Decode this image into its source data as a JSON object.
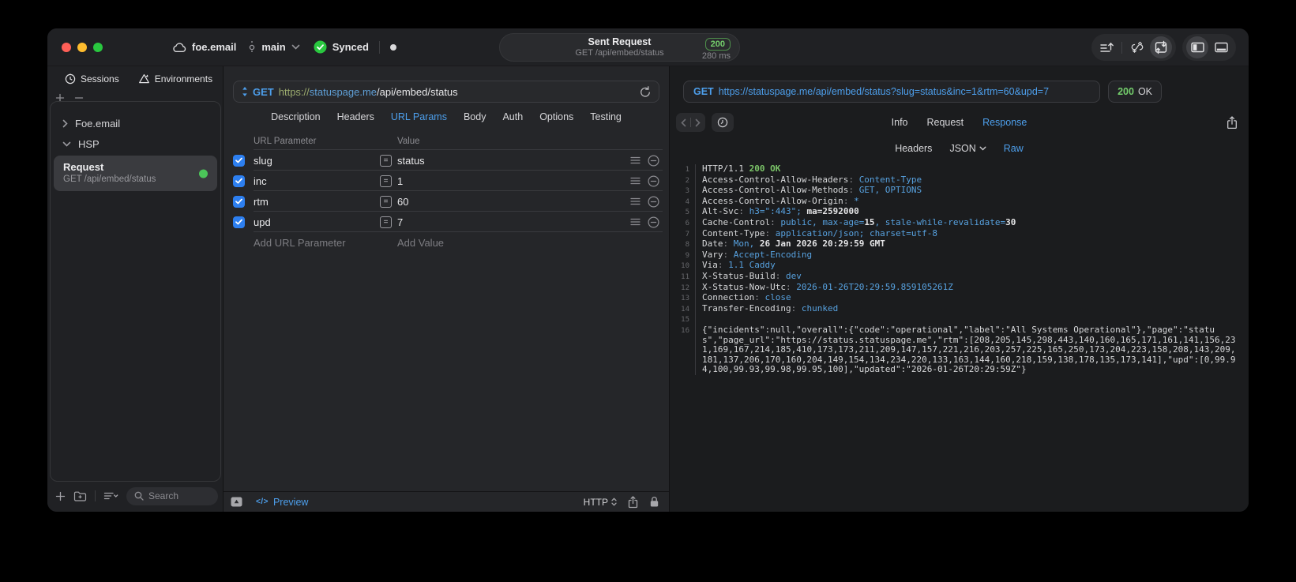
{
  "colors": {
    "accent_blue": "#4D9FEC",
    "status_green": "#74CE6C",
    "checkbox_blue": "#2D7FF0",
    "synced_green": "#29C73F"
  },
  "titlebar": {
    "workspace": "foe.email",
    "branch": "main",
    "sync_label": "Synced",
    "center": {
      "title": "Sent Request",
      "subtitle": "GET /api/embed/status",
      "status_code": "200",
      "duration": "280 ms"
    }
  },
  "sidebar": {
    "tabs": [
      {
        "label": "Sessions"
      },
      {
        "label": "Environments"
      }
    ],
    "tree": [
      {
        "label": "Foe.email"
      },
      {
        "label": "HSP"
      }
    ],
    "request": {
      "title": "Request",
      "subtitle": "GET /api/embed/status"
    },
    "search_placeholder": "Search"
  },
  "request_panel": {
    "method": "GET",
    "url_scheme": "https://",
    "url_host": "statuspage.me",
    "url_path": "/api/embed/status",
    "tabs": [
      "Description",
      "Headers",
      "URL Params",
      "Body",
      "Auth",
      "Options",
      "Testing"
    ],
    "active_tab": "URL Params",
    "table": {
      "col_name": "URL Parameter",
      "col_value": "Value",
      "rows": [
        {
          "name": "slug",
          "value": "status"
        },
        {
          "name": "inc",
          "value": "1"
        },
        {
          "name": "rtm",
          "value": "60"
        },
        {
          "name": "upd",
          "value": "7"
        }
      ],
      "add_name": "Add URL Parameter",
      "add_value": "Add Value"
    },
    "footer": {
      "preview_icon": "</>",
      "preview": "Preview",
      "protocol": "HTTP"
    }
  },
  "response_panel": {
    "method": "GET",
    "url": "https://statuspage.me/api/embed/status?slug=status&inc=1&rtm=60&upd=7",
    "status_code": "200",
    "status_text": "OK",
    "tabs": [
      "Info",
      "Request",
      "Response"
    ],
    "active_tab": "Response",
    "subtabs": [
      "Headers",
      "JSON",
      "Raw"
    ],
    "active_subtab": "Raw",
    "code_lines": [
      {
        "n": "1",
        "parts": [
          [
            "HTTP/1.1 ",
            "w"
          ],
          [
            "200 OK",
            "g"
          ]
        ]
      },
      {
        "n": "2",
        "parts": [
          [
            "Access-Control-Allow-Headers",
            "w"
          ],
          [
            ": ",
            "p"
          ],
          [
            "Content-Type",
            "v"
          ]
        ]
      },
      {
        "n": "3",
        "parts": [
          [
            "Access-Control-Allow-Methods",
            "w"
          ],
          [
            ": ",
            "p"
          ],
          [
            "GET, OPTIONS",
            "v"
          ]
        ]
      },
      {
        "n": "4",
        "parts": [
          [
            "Access-Control-Allow-Origin",
            "w"
          ],
          [
            ": ",
            "p"
          ],
          [
            "*",
            "v"
          ]
        ]
      },
      {
        "n": "5",
        "parts": [
          [
            "Alt-Svc",
            "w"
          ],
          [
            ": ",
            "p"
          ],
          [
            "h3=\":443\"; ",
            "v"
          ],
          [
            "ma=2592000",
            "n"
          ]
        ]
      },
      {
        "n": "6",
        "parts": [
          [
            "Cache-Control",
            "w"
          ],
          [
            ": ",
            "p"
          ],
          [
            "public, max-age=",
            "v"
          ],
          [
            "15",
            "n"
          ],
          [
            ", stale-while-revalidate=",
            "v"
          ],
          [
            "30",
            "n"
          ]
        ]
      },
      {
        "n": "7",
        "parts": [
          [
            "Content-Type",
            "w"
          ],
          [
            ": ",
            "p"
          ],
          [
            "application/json; charset=utf-8",
            "v"
          ]
        ]
      },
      {
        "n": "8",
        "parts": [
          [
            "Date",
            "w"
          ],
          [
            ": ",
            "p"
          ],
          [
            "Mon, ",
            "v"
          ],
          [
            "26 Jan 2026 20:29:59 GMT",
            "n"
          ]
        ]
      },
      {
        "n": "9",
        "parts": [
          [
            "Vary",
            "w"
          ],
          [
            ": ",
            "p"
          ],
          [
            "Accept-Encoding",
            "v"
          ]
        ]
      },
      {
        "n": "10",
        "parts": [
          [
            "Via",
            "w"
          ],
          [
            ": ",
            "p"
          ],
          [
            "1.1 Caddy",
            "v"
          ]
        ]
      },
      {
        "n": "11",
        "parts": [
          [
            "X-Status-Build",
            "w"
          ],
          [
            ": ",
            "p"
          ],
          [
            "dev",
            "v"
          ]
        ]
      },
      {
        "n": "12",
        "parts": [
          [
            "X-Status-Now-Utc",
            "w"
          ],
          [
            ": ",
            "p"
          ],
          [
            "2026-01-26T20:29:59.859105261Z",
            "v"
          ]
        ]
      },
      {
        "n": "13",
        "parts": [
          [
            "Connection",
            "w"
          ],
          [
            ": ",
            "p"
          ],
          [
            "close",
            "v"
          ]
        ]
      },
      {
        "n": "14",
        "parts": [
          [
            "Transfer-Encoding",
            "w"
          ],
          [
            ": ",
            "p"
          ],
          [
            "chunked",
            "v"
          ]
        ]
      },
      {
        "n": "15",
        "parts": []
      },
      {
        "n": "16",
        "wrap": true,
        "parts": [
          [
            "{\"incidents\":null,\"overall\":{\"code\":\"operational\",\"label\":\"All Systems Operational\"},\"page\":\"status\",\"page_url\":\"https://status.statuspage.me\",\"rtm\":[208,205,145,298,443,140,160,165,171,161,141,156,231,169,167,214,185,410,173,173,211,209,147,157,221,216,203,257,225,165,250,173,204,223,158,208,143,209,181,137,206,170,160,204,149,154,134,234,220,133,163,144,160,218,159,138,178,135,173,141],\"upd\":[0,99.94,100,99.93,99.98,99.95,100],\"updated\":\"2026-01-26T20:29:59Z\"}",
            "w"
          ]
        ]
      }
    ]
  }
}
